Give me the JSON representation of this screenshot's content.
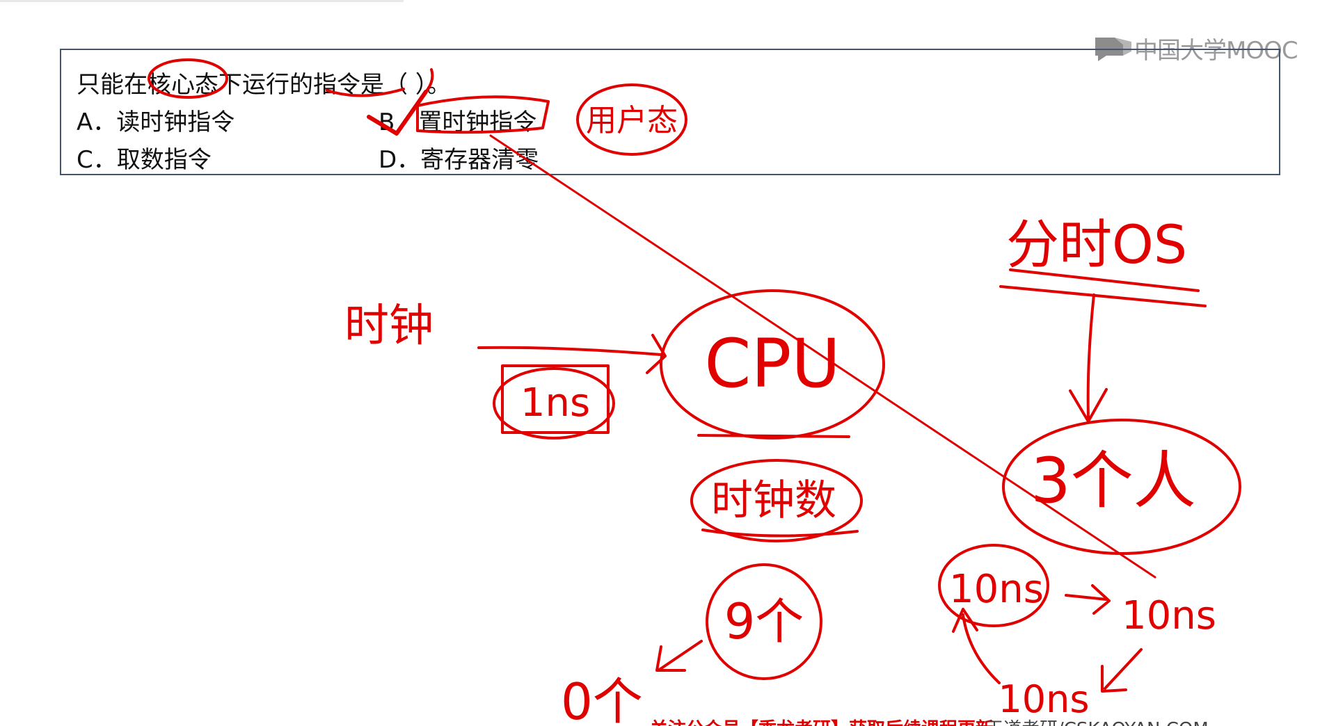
{
  "logo": {
    "text": "中国大学MOOC",
    "icon": "mooc-logo-icon"
  },
  "question": {
    "stem": "只能在核心态下运行的指令是（   ）。",
    "options": [
      {
        "label": "A．读时钟指令"
      },
      {
        "label": "B．置时钟指令"
      },
      {
        "label": "C．取数指令"
      },
      {
        "label": "D．寄存器清零"
      }
    ]
  },
  "annotations": {
    "user_mode": "用户态",
    "clock": "时钟",
    "interval": "1ns",
    "cpu": "CPU",
    "clock_count": "时钟数",
    "count_start": "9个",
    "count_end": "0个",
    "time_sharing": "分时OS",
    "users": "3个人",
    "slice_1": "10ns",
    "slice_2": "10ns",
    "slice_3": "10ns"
  },
  "footer": {
    "left": "关注公众号【乖龙考研】获取后续课程更新",
    "right": "王道考研/CSKAOYAN.COM"
  },
  "colors": {
    "ink": "#e00000",
    "box_border": "#44546a",
    "logo": "#9a9a9a"
  }
}
